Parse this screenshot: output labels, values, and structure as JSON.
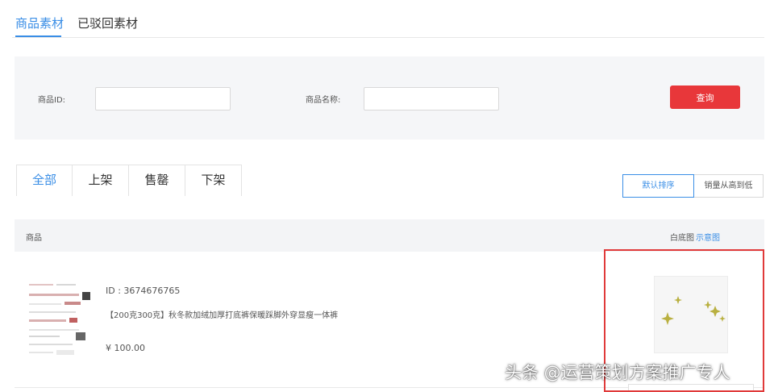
{
  "top_tabs": [
    {
      "label": "商品素材",
      "active": true
    },
    {
      "label": "已驳回素材",
      "active": false
    }
  ],
  "search": {
    "id_label": "商品ID:",
    "id_value": "",
    "name_label": "商品名称:",
    "name_value": "",
    "button_label": "查询",
    "button_color": "#e8373a"
  },
  "status_tabs": [
    {
      "label": "全部",
      "active": true
    },
    {
      "label": "上架",
      "active": false
    },
    {
      "label": "售罄",
      "active": false
    },
    {
      "label": "下架",
      "active": false
    }
  ],
  "sort": {
    "default_label": "默认排序",
    "sales_label": "销量从高到低"
  },
  "table": {
    "col_product": "商品",
    "col_white_bg": "白底图",
    "col_example_link": "示意图"
  },
  "product": {
    "id_text": "ID : 3674676765",
    "title": "【200克300克】秋冬款加绒加厚打底裤保暖踩脚外穿显瘦一体裤",
    "price": "¥ 100.00",
    "thumbnail_icon": "product-thumbnail",
    "preview_icon": "sparkle-icon"
  },
  "watermark": "头条 @运营策划方案推广专人",
  "colors": {
    "accent": "#3a8ee6",
    "highlight_border": "#e03a3a",
    "panel_bg": "#f5f6f8"
  }
}
